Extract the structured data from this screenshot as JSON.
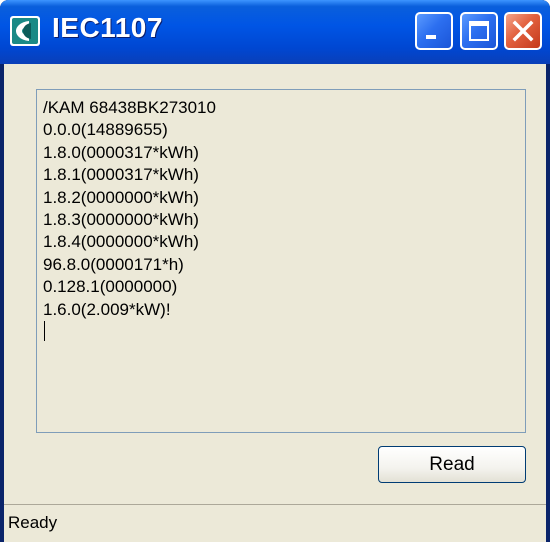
{
  "window": {
    "title": "IEC1107",
    "icon": "iec1107-app-icon",
    "controls": {
      "minimize_icon": "minimize-icon",
      "maximize_icon": "maximize-icon",
      "close_icon": "close-icon"
    }
  },
  "output": {
    "lines": [
      "/KAM 68438BK273010",
      "0.0.0(14889655)",
      "1.8.0(0000317*kWh)",
      "1.8.1(0000317*kWh)",
      "1.8.2(0000000*kWh)",
      "1.8.3(0000000*kWh)",
      "1.8.4(0000000*kWh)",
      "96.8.0(0000171*h)",
      "0.128.1(0000000)",
      "1.6.0(2.009*kW)!"
    ]
  },
  "buttons": {
    "read_label": "Read"
  },
  "status": {
    "text": "Ready"
  }
}
